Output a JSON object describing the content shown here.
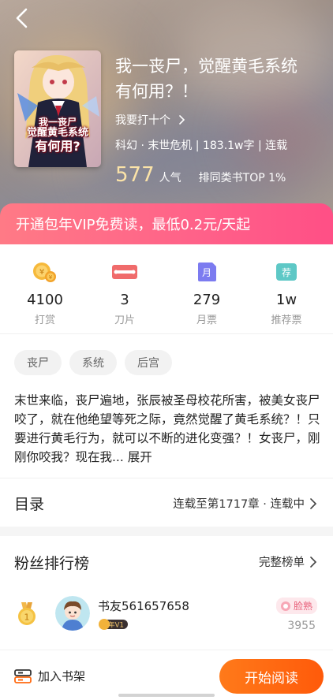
{
  "book": {
    "title": "我一丧尸，觉醒黄毛系统有何用？！",
    "author": "我要打十个",
    "meta": "科幻 · 末世危机 | 183.1w字 | 连载",
    "popularity_value": "577",
    "popularity_label": "人气",
    "rank_text": "排同类书TOP 1%",
    "cover_text": {
      "line1": "我一丧尸",
      "line2": "觉醒黄毛系统",
      "line3": "有何用?"
    }
  },
  "vip_banner": "开通包年VIP免费读，最低0.2元/天起",
  "stats": [
    {
      "value": "4100",
      "label": "打赏",
      "icon": "coins-icon"
    },
    {
      "value": "3",
      "label": "刀片",
      "icon": "blade-icon"
    },
    {
      "value": "279",
      "label": "月票",
      "icon": "monthly-ticket-icon"
    },
    {
      "value": "1w",
      "label": "推荐票",
      "icon": "recommend-ticket-icon"
    }
  ],
  "icon_text": {
    "monthly": "月",
    "recommend": "荐"
  },
  "tags": [
    "丧尸",
    "系统",
    "后宫"
  ],
  "description": "末世来临，丧尸遍地，张辰被圣母校花所害，被美女丧尸咬了，就在他绝望等死之际，竟然觉醒了黄毛系统？！只要进行黄毛行为，就可以不断的进化变强？！女丧尸，刚刚你咬我？现在我...",
  "expand_label": "展开",
  "catalog": {
    "title": "目录",
    "status": "连载至第1717章 · 连载中"
  },
  "fans": {
    "title": "粉丝排行榜",
    "more_label": "完整榜单",
    "top": {
      "rank": "1",
      "name": "书友561657658",
      "badge": "年V1",
      "level": "脸熟",
      "score": "3955"
    }
  },
  "bottom": {
    "shelf_label": "加入书架",
    "read_label": "开始阅读"
  },
  "colors": {
    "accent_orange": "#ff6a10",
    "vip_pink": "#ff6189",
    "popularity_gold": "#fbe3a8"
  }
}
